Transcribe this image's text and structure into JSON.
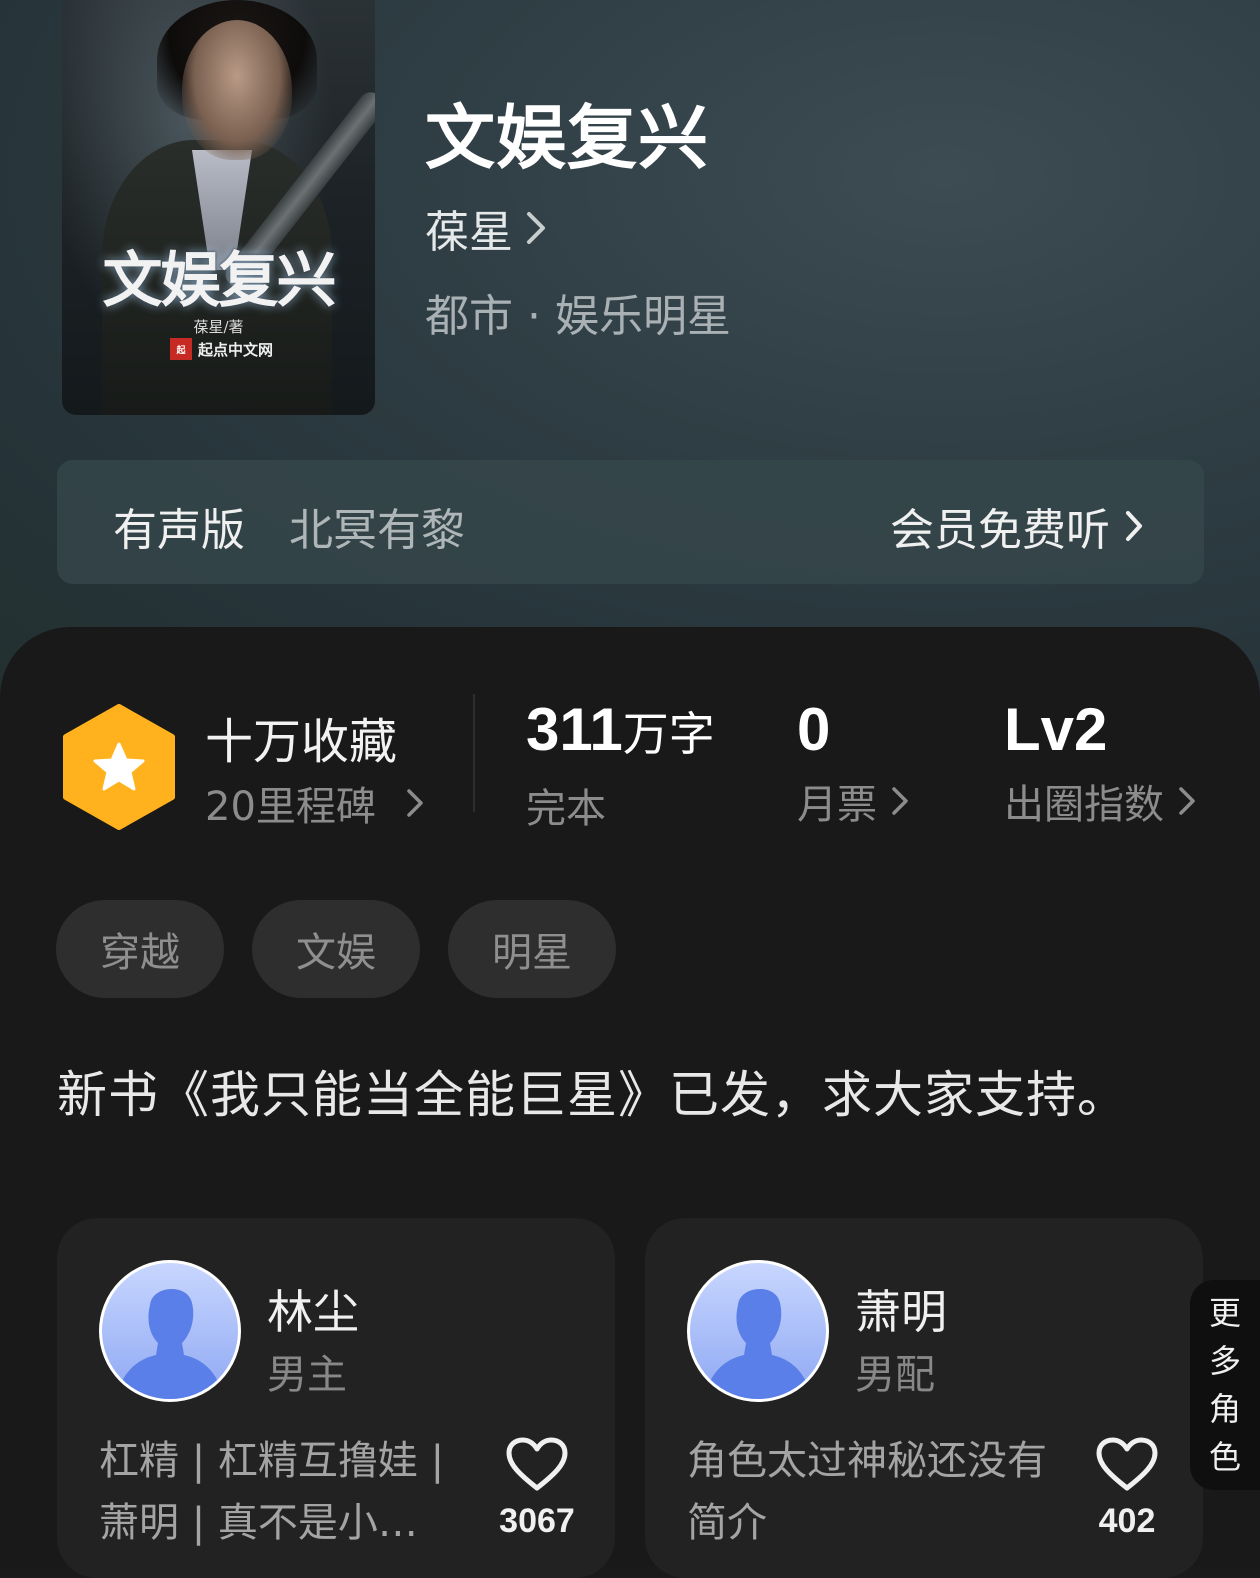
{
  "book": {
    "title": "文娱复兴",
    "author": "葆星",
    "genre": "都市 · 娱乐明星",
    "cover": {
      "title": "文娱复兴",
      "author_line": "葆星/著",
      "publisher": "起点中文网"
    }
  },
  "audio": {
    "label": "有声版",
    "narrator": "北冥有黎",
    "cta": "会员免费听"
  },
  "milestone": {
    "title": "十万收藏",
    "subtitle": "20里程碑"
  },
  "stats": {
    "words": {
      "value": "311",
      "unit": "万字",
      "label": "完本"
    },
    "monthly_tickets": {
      "value": "0",
      "label": "月票"
    },
    "breakout": {
      "value": "Lv2",
      "label": "出圈指数"
    }
  },
  "tags": [
    "穿越",
    "文娱",
    "明星"
  ],
  "notice": "新书《我只能当全能巨星》已发，求大家支持。",
  "characters": [
    {
      "name": "林尘",
      "role": "男主",
      "desc": "杠精 | 杠精互撸娃 | 萧明 | 真不是小…",
      "likes": "3067"
    },
    {
      "name": "萧明",
      "role": "男配",
      "desc": "角色太过神秘还没有简介",
      "likes": "402"
    }
  ],
  "more_roles": [
    "更",
    "多",
    "角",
    "色"
  ],
  "colors": {
    "accent_badge": "#FFB21E",
    "panel_bg": "#191919",
    "hero_bg": "#2f3e44"
  }
}
